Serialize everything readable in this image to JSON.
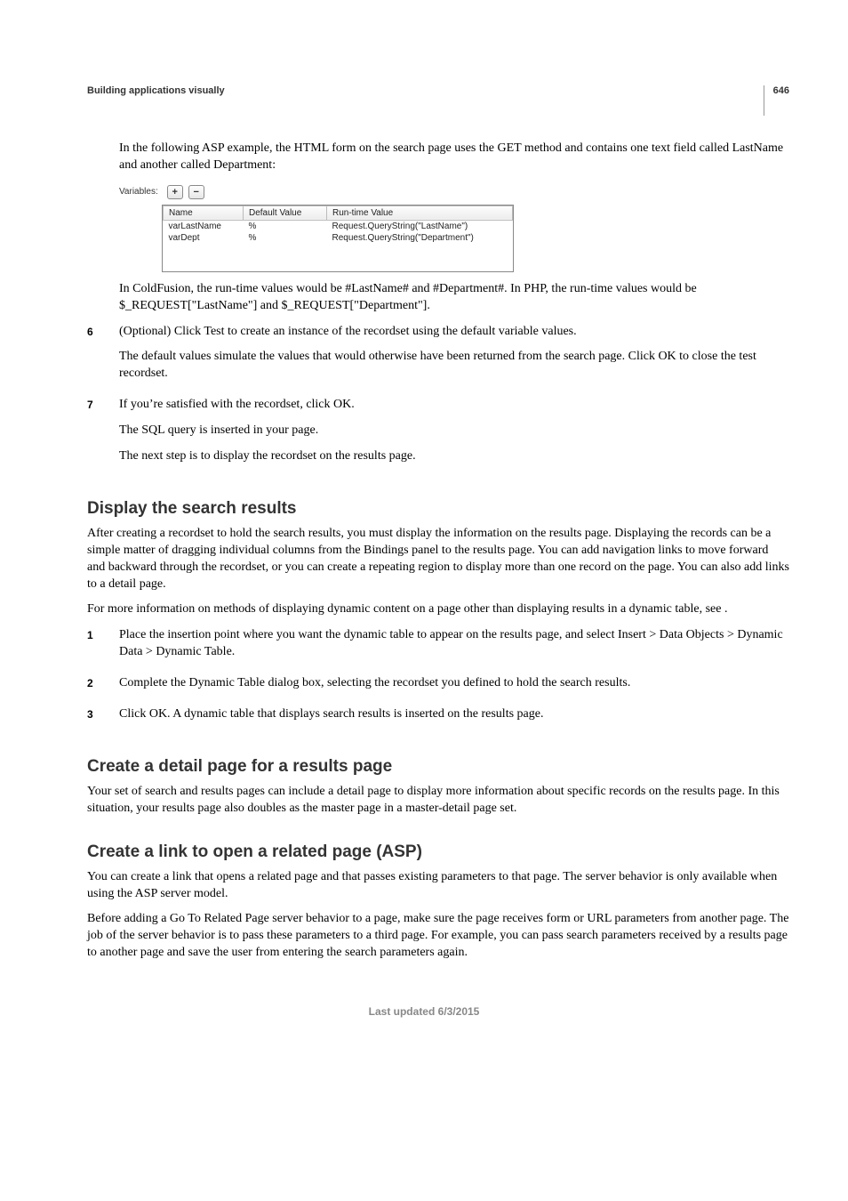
{
  "page_number": "646",
  "section_header": "Building applications visually",
  "intro_p1": "In the following ASP example, the HTML form on the search page uses the GET method and contains one text field called LastName and another called Department:",
  "variables_panel": {
    "label": "Variables:",
    "plus": "+",
    "minus": "−",
    "headers": {
      "name": "Name",
      "default": "Default Value",
      "runtime": "Run-time Value"
    },
    "rows": [
      {
        "name": "varLastName",
        "default": "%",
        "runtime": "Request.QueryString(\"LastName\")"
      },
      {
        "name": "varDept",
        "default": "%",
        "runtime": "Request.QueryString(\"Department\")"
      }
    ]
  },
  "intro_p2": "In ColdFusion, the run-time values would be #LastName# and #Department#. In PHP, the run-time values would be $_REQUEST[\"LastName\"] and $_REQUEST[\"Department\"].",
  "step6": {
    "num": "6",
    "p1": "(Optional) Click Test to create an instance of the recordset using the default variable values.",
    "p2": "The default values simulate the values that would otherwise have been returned from the search page. Click OK to close the test recordset."
  },
  "step7": {
    "num": "7",
    "p1": "If you’re satisfied with the recordset, click OK.",
    "p2": "The SQL query is inserted in your page.",
    "p3": "The next step is to display the recordset on the results page."
  },
  "display_results": {
    "heading": "Display the search results",
    "p1": "After creating a recordset to hold the search results, you must display the information on the results page. Displaying the records can be a simple matter of dragging individual columns from the Bindings panel to the results page. You can add navigation links to move forward and backward through the recordset, or you can create a repeating region to display more than one record on the page. You can also add links to a detail page.",
    "p2": "For more information on methods of displaying dynamic content on a page other than displaying results in a dynamic table, see .",
    "s1": {
      "num": "1",
      "text": "Place the insertion point where you want the dynamic table to appear on the results page, and select Insert > Data Objects > Dynamic Data > Dynamic Table."
    },
    "s2": {
      "num": "2",
      "text": "Complete the Dynamic Table dialog box, selecting the recordset you defined to hold the search results."
    },
    "s3": {
      "num": "3",
      "text": "Click OK. A dynamic table that displays search results is inserted on the results page."
    }
  },
  "detail_page": {
    "heading": "Create a detail page for a results page",
    "p1": "Your set of search and results pages can include a detail page to display more information about specific records on the results page. In this situation, your results page also doubles as the master page in a master-detail page set."
  },
  "related_link": {
    "heading": "Create a link to open a related page (ASP)",
    "p1": "You can create a link that opens a related page and that passes existing parameters to that page. The server behavior is only available when using the ASP server model.",
    "p2": "Before adding a Go To Related Page server behavior to a page, make sure the page receives form or URL parameters from another page. The job of the server behavior is to pass these parameters to a third page. For example, you can pass search parameters received by a results page to another page and save the user from entering the search parameters again."
  },
  "footer": "Last updated 6/3/2015"
}
